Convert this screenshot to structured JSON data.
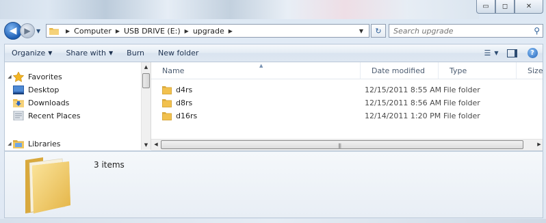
{
  "window": {
    "caption": {
      "minimize": "▭",
      "maximize": "◻",
      "close": "✕"
    }
  },
  "address": {
    "crumbs": [
      "Computer",
      "USB DRIVE (E:)",
      "upgrade"
    ],
    "search_placeholder": "Search upgrade"
  },
  "toolbar": {
    "organize": "Organize",
    "share": "Share with",
    "burn": "Burn",
    "new_folder": "New folder"
  },
  "nav": {
    "favorites": "Favorites",
    "desktop": "Desktop",
    "downloads": "Downloads",
    "recent": "Recent Places",
    "libraries": "Libraries"
  },
  "columns": {
    "name": "Name",
    "date": "Date modified",
    "type": "Type",
    "size": "Size"
  },
  "files": [
    {
      "name": "d4rs",
      "date": "12/15/2011 8:55 AM",
      "type": "File folder"
    },
    {
      "name": "d8rs",
      "date": "12/15/2011 8:56 AM",
      "type": "File folder"
    },
    {
      "name": "d16rs",
      "date": "12/14/2011 1:20 PM",
      "type": "File folder"
    }
  ],
  "details": {
    "count": "3 items"
  },
  "colors": {
    "folder": "#f2c14e",
    "accent": "#1e5fb4"
  }
}
